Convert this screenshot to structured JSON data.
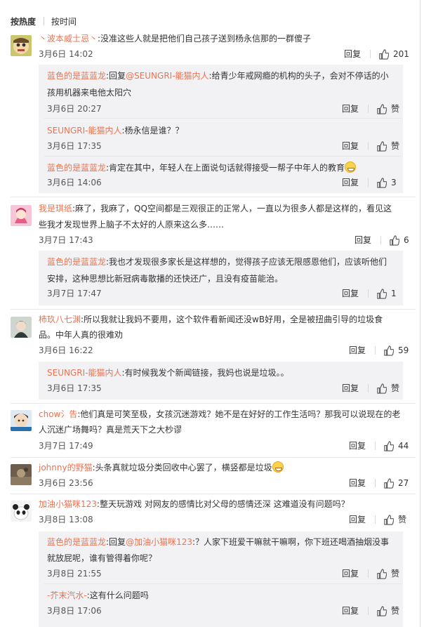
{
  "sort": {
    "hot": "按热度",
    "time": "按时间"
  },
  "actions": {
    "reply": "回复",
    "like": "赞"
  },
  "comments": [
    {
      "user": "丶波本威士忌丶",
      "text": [
        ":没准这些人就是把他们自己孩子送到杨永信那的一群傻子"
      ],
      "time": "3月6日 14:02",
      "likes": "201",
      "replies": [
        {
          "user": "蓝色的是蓝蓝龙",
          "mid": ":回复",
          "mention": "@SEUNGRI-能猫内人",
          "text": [
            ":给青少年戒网瘾的机构的头子，会对不停话的小",
            "孩用机器来电他太阳穴"
          ],
          "time": "3月6日 20:27",
          "likes": "赞"
        },
        {
          "user": "SEUNGRI-能猫内人",
          "text": [
            ":杨永信是谁？？"
          ],
          "time": "3月6日 17:35",
          "likes": "赞"
        },
        {
          "user": "蓝色的是蓝蓝龙",
          "text": [
            ":肯定在其中，年轻人在上面说句话就得接受一帮子中年人的教育"
          ],
          "time": "3月6日 14:06",
          "likes": "3"
        }
      ]
    },
    {
      "user": "我是琪纸",
      "text": [
        ":麻了，我麻了，QQ空间都是三观很正的正常人，一直以为很多人都是这样的，看见这",
        "些我才发现世界上脑子不太好的人原来这么多……"
      ],
      "time": "3月7日 17:43",
      "likes": "6",
      "replies": [
        {
          "user": "蓝色的是蓝蓝龙",
          "text": [
            ":我也才发现很多家长是这样想的，觉得孩子应该无限感恩他们，应该听他们",
            "安排，这种思想比新冠病毒散播的还快还广，且没有疫苗能治。"
          ],
          "time": "3月7日 17:47",
          "likes": "1"
        }
      ]
    },
    {
      "user": "柿玖八七渊",
      "text": [
        ":所以我就让我妈不要用，这个软件看新闻还没wB好用，全是被扭曲引导的垃圾食",
        "品。中年人真的很难劝"
      ],
      "time": "3月6日 16:22",
      "likes": "59",
      "replies": [
        {
          "user": "SEUNGRI-能猫内人",
          "text": [
            ":有时候我发个新闻链接，我妈也说是垃圾。。"
          ],
          "time": "3月6日 17:35",
          "likes": "赞"
        }
      ]
    },
    {
      "user": "chow氵告",
      "text": [
        ":他们真是可笑至极，女孩沉迷游戏？她不是在好好的工作生活吗？那我可以说现在的老",
        "人沉迷广场舞吗？真是荒天下之大杪谬"
      ],
      "time": "3月7日 17:49",
      "likes": "44",
      "replies": []
    },
    {
      "user": "johnny的野猫",
      "text": [
        ":头条真就垃圾分类回收中心罢了，横竖都是垃圾"
      ],
      "time": "3月6日 23:56",
      "likes": "27",
      "replies": []
    },
    {
      "user": "加油小猫咪123",
      "text": [
        ":整天玩游戏 对网友的感情比对父母的感情还深 这难道没有问题吗？"
      ],
      "time": "3月8日 13:08",
      "likes": "赞",
      "replies": [
        {
          "user": "蓝色的是蓝蓝龙",
          "mid": ":回复",
          "mention": "@加油小猫咪123",
          "text": [
            ":？人家下班爱干嘛就干嘛啊，你下班还喝酒抽烟没事",
            "就放屁呢，谁有管得着你呢？"
          ],
          "time": "3月8日 21:55",
          "likes": "赞"
        },
        {
          "user": "-芥末汽水-",
          "text": [
            ":这有什么问题吗"
          ],
          "time": "3月8日 17:06",
          "likes": "赞"
        }
      ]
    }
  ]
}
